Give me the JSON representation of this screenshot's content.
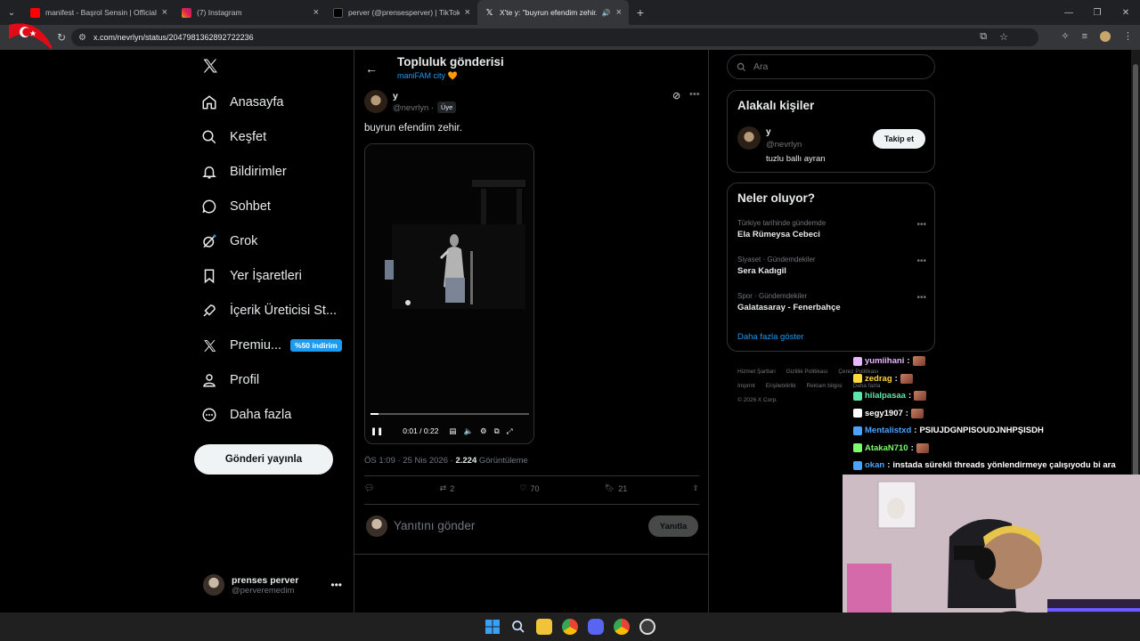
{
  "browser": {
    "tabs": [
      {
        "title": "manifest - Başrol Sensin | Official",
        "favicon_color": "#ff0000"
      },
      {
        "title": "(7) Instagram",
        "favicon_color": "#e1306c"
      },
      {
        "title": "perver (@prensesperver) | TikTok",
        "favicon_color": "#ffffff"
      },
      {
        "title": "X'te y: \"buyrun efendim zehir.\"",
        "favicon_color": "#ffffff"
      }
    ],
    "url": "x.com/nevrlyn/status/2047981362892722236"
  },
  "nav": {
    "items": [
      {
        "label": "Anasayfa",
        "icon": "home-icon"
      },
      {
        "label": "Keşfet",
        "icon": "search-icon"
      },
      {
        "label": "Bildirimler",
        "icon": "bell-icon"
      },
      {
        "label": "Sohbet",
        "icon": "chat-icon"
      },
      {
        "label": "Grok",
        "icon": "grok-icon"
      },
      {
        "label": "Yer İşaretleri",
        "icon": "bookmark-icon"
      },
      {
        "label": "İçerik Üreticisi St...",
        "icon": "rocket-icon"
      },
      {
        "label": "Premiu...",
        "icon": "x-icon"
      },
      {
        "label": "Profil",
        "icon": "person-icon"
      },
      {
        "label": "Daha fazla",
        "icon": "more-circle-icon"
      }
    ],
    "premium_badge": "%50 indirim",
    "post_button": "Gönderi yayınla",
    "me": {
      "name": "prenses perver",
      "handle": "@perveremedim"
    }
  },
  "post": {
    "header_title": "Topluluk gönderisi",
    "community": "maniFAM city 🧡",
    "author_name": "y",
    "author_handle": "@nevrlyn ·",
    "member_badge": "Üye",
    "text": "buyrun efendim zehir.",
    "video": {
      "time": "0:01 / 0:22",
      "progress": 0.05
    },
    "time": "ÖS 1:09 · 25 Nis 2026 ·",
    "views": "2.224",
    "views_label": "Görüntüleme",
    "stats": {
      "reposts": "2",
      "likes": "70",
      "bookmarks": "21"
    },
    "reply_placeholder": "Yanıtını gönder",
    "reply_button": "Yanıtla"
  },
  "right": {
    "search_placeholder": "Ara",
    "related_title": "Alakalı kişiler",
    "related": {
      "name": "y",
      "handle": "@nevrlyn",
      "bio": "tuzlu ballı ayran",
      "follow": "Takip et"
    },
    "trends_title": "Neler oluyor?",
    "trends": [
      {
        "context": "Türkiye tarihinde gündemde",
        "name": "Ela Rümeysa Cebeci"
      },
      {
        "context": "Siyaset · Gündemdekiler",
        "name": "Sera Kadıgil"
      },
      {
        "context": "Spor · Gündemdekiler",
        "name": "Galatasaray - Fenerbahçe"
      }
    ],
    "show_more": "Daha fazla göster",
    "footer": [
      "Hizmet Şartları",
      "Gizlilik Politikası",
      "Çerez Politikası",
      "Imprint",
      "Erişilebilirlik",
      "Reklam bilgisi",
      "Daha fazla",
      "© 2026 X Corp."
    ]
  },
  "chat": [
    {
      "user": "yumiihani",
      "color": "#e6b8ff",
      "msg": ""
    },
    {
      "user": "zedrag",
      "color": "#ffd93b",
      "msg": ""
    },
    {
      "user": "hilalpasaa",
      "color": "#5ee6a8",
      "msg": ""
    },
    {
      "user": "segy1907",
      "color": "#ffffff",
      "msg": ""
    },
    {
      "user": "Mentalistxd",
      "color": "#4aa3ff",
      "msg": "PSIUJDGNPISOUDJNHPŞISDH"
    },
    {
      "user": "AtakaN710",
      "color": "#7cff6b",
      "msg": ""
    },
    {
      "user": "okan",
      "color": "#4aa3ff",
      "msg": "instada sürekli threads yönlendirmeye çalışıyodu bi ara"
    }
  ]
}
